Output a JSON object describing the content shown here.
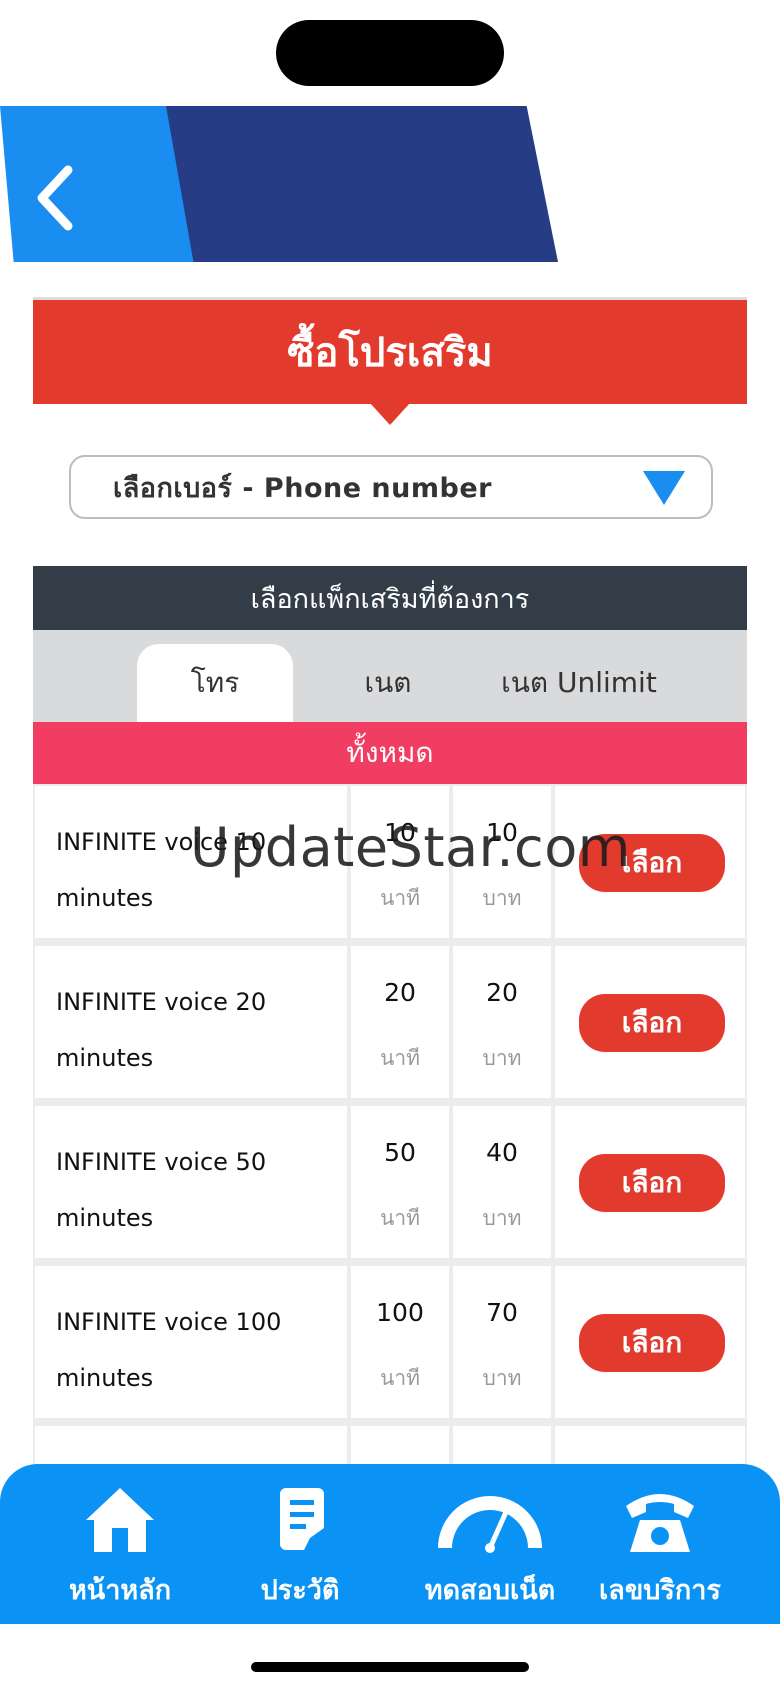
{
  "page": {
    "title": "ซื้อโปรเสริม",
    "number_select": {
      "label": "เลือกเบอร์ - Phone number"
    },
    "section_title": "เลือกแพ็กเสริมที่ต้องการ",
    "tabs": [
      {
        "label": "โทร",
        "active": true
      },
      {
        "label": "เนต",
        "active": false
      },
      {
        "label": "เนต Unlimit",
        "active": false
      }
    ],
    "filter_label": "ทั้งหมด"
  },
  "packages": [
    {
      "name": "INFINITE voice 10 minutes",
      "minutes": "10",
      "minutes_unit": "นาที",
      "price": "10",
      "price_unit": "บาท",
      "select_label": "เลือก"
    },
    {
      "name": "INFINITE voice 20 minutes",
      "minutes": "20",
      "minutes_unit": "นาที",
      "price": "20",
      "price_unit": "บาท",
      "select_label": "เลือก"
    },
    {
      "name": "INFINITE voice 50 minutes",
      "minutes": "50",
      "minutes_unit": "นาที",
      "price": "40",
      "price_unit": "บาท",
      "select_label": "เลือก"
    },
    {
      "name": "INFINITE voice 100 minutes",
      "minutes": "100",
      "minutes_unit": "นาที",
      "price": "70",
      "price_unit": "บาท",
      "select_label": "เลือก"
    }
  ],
  "watermark": "UpdateStar.com",
  "bottom_nav": [
    {
      "label": "หน้าหลัก",
      "icon": "home-icon"
    },
    {
      "label": "ประวัติ",
      "icon": "history-icon"
    },
    {
      "label": "ทดสอบเน็ต",
      "icon": "speedometer-icon"
    },
    {
      "label": "เลขบริการ",
      "icon": "phone-icon"
    }
  ],
  "colors": {
    "brand_blue": "#1a8ef0",
    "navy": "#263d86",
    "accent_red": "#e23b2e",
    "filter_pink": "#f23d62",
    "section_dark": "#323d48",
    "nav_blue": "#0a93f5"
  }
}
